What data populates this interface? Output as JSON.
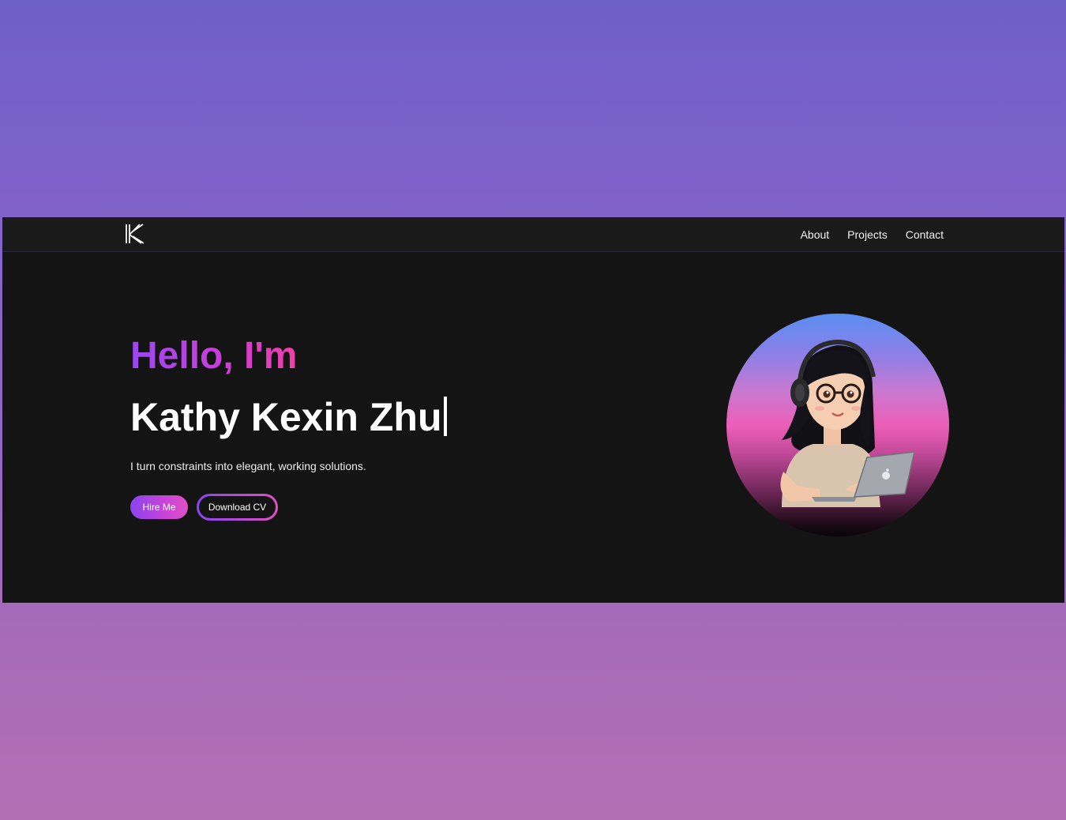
{
  "navbar": {
    "logo_icon": "k-monogram-logo-icon",
    "links": [
      "About",
      "Projects",
      "Contact"
    ]
  },
  "hero": {
    "greeting": "Hello, I'm",
    "name": "Kathy Kexin Zhu",
    "tagline": "I turn constraints into elegant, working solutions.",
    "hire_button": "Hire Me",
    "cv_button": "Download CV"
  },
  "avatar": {
    "icon": "avatar-girl-with-headphones-and-laptop-icon"
  },
  "colors": {
    "background_gradient": [
      "#6e5fc7",
      "#b36fb3"
    ],
    "window_bg": "#141414",
    "navbar_bg": "#1a1a1a",
    "accent_start": "#9b47f0",
    "accent_end": "#ee3fa7"
  }
}
